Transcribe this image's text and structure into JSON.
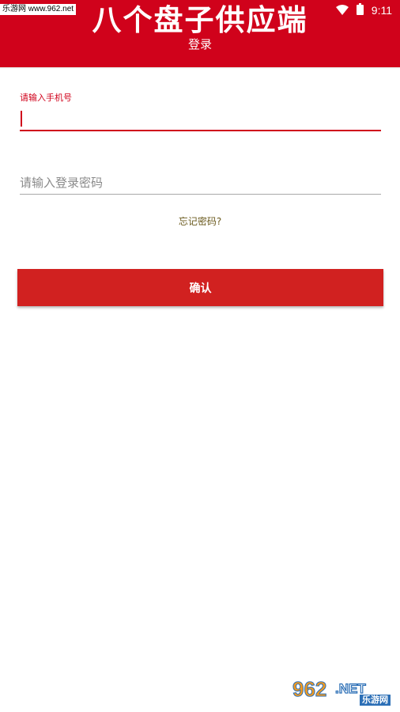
{
  "status_bar": {
    "watermark_text": "乐游网 www.962.net",
    "time": "9:11"
  },
  "header": {
    "app_name": "八个盘子供应端",
    "page_title": "登录"
  },
  "form": {
    "phone_label": "请输入手机号",
    "phone_value": "",
    "password_placeholder": "请输入登录密码",
    "password_value": "",
    "forgot_password": "忘记密码?",
    "confirm_label": "确认"
  },
  "watermark": {
    "brand_number": "962",
    "brand_suffix": ".NET",
    "brand_name": "乐游网"
  },
  "colors": {
    "primary": "#d0021b",
    "button": "#d12120",
    "link": "#6b5a1e"
  }
}
